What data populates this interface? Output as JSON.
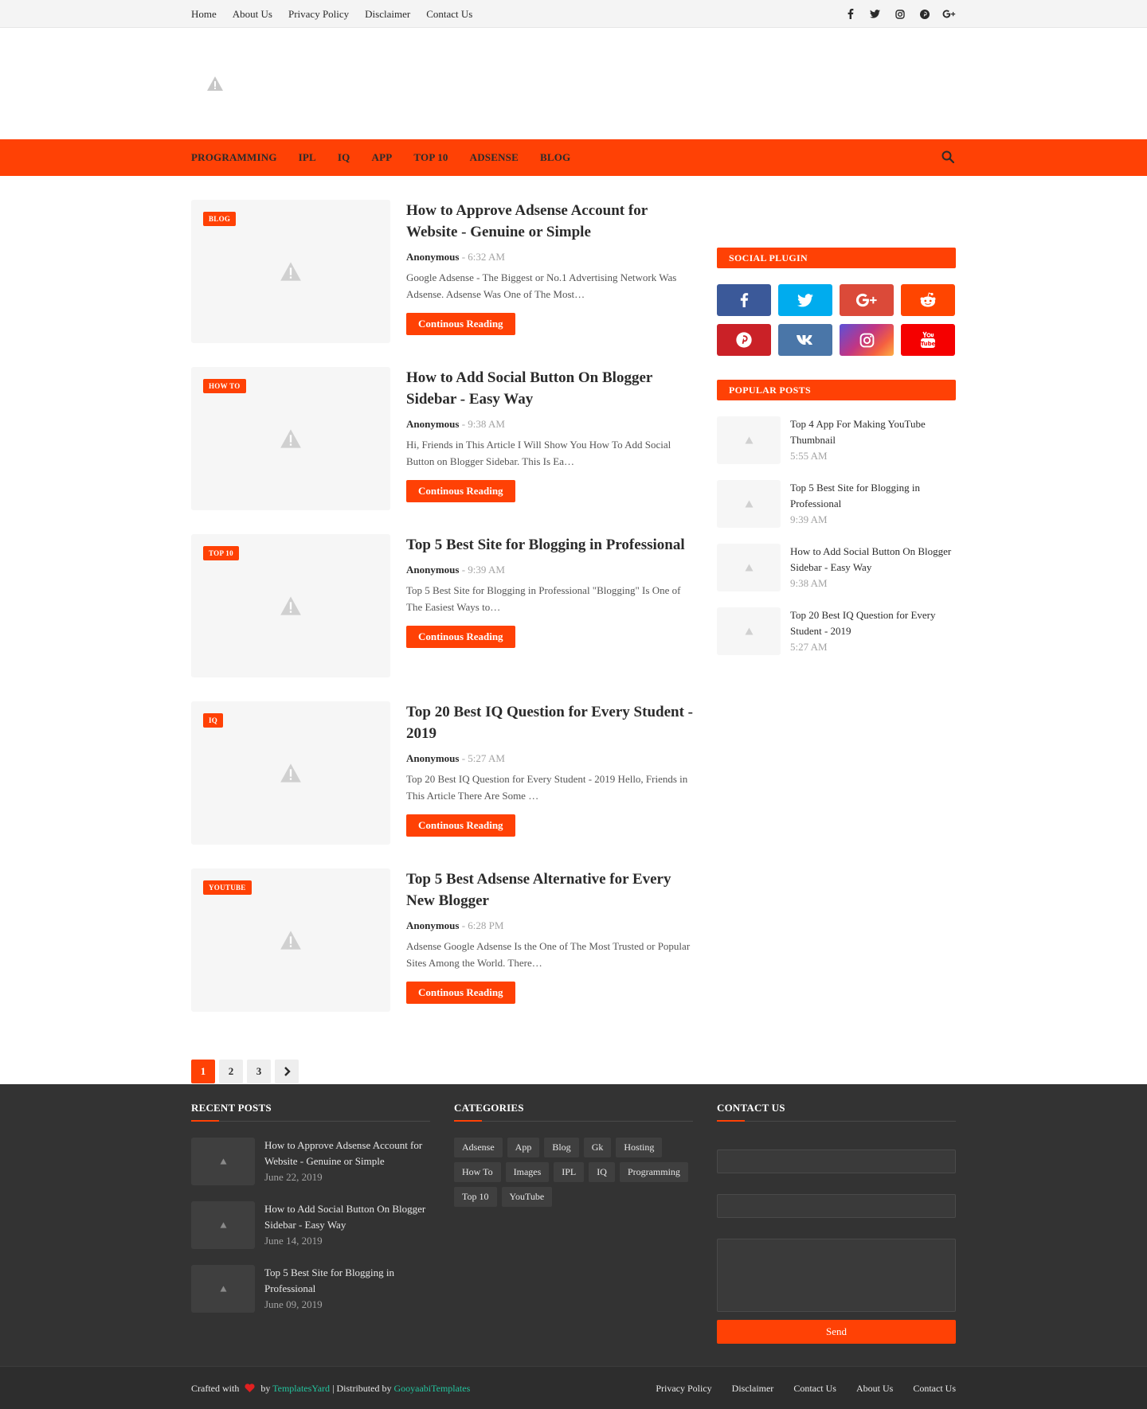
{
  "topbar": {
    "links": [
      "Home",
      "About Us",
      "Privacy Policy",
      "Disclaimer",
      "Contact Us"
    ],
    "social_icons": [
      "facebook-icon",
      "twitter-icon",
      "instagram-icon",
      "pinterest-icon",
      "google-plus-icon"
    ]
  },
  "nav": {
    "items": [
      "PROGRAMMING",
      "IPL",
      "IQ",
      "APP",
      "TOP 10",
      "ADSENSE",
      "BLOG"
    ]
  },
  "colors": {
    "accent": "#ff4105",
    "footer_bg": "#333333",
    "link_green": "#23c49e"
  },
  "posts": [
    {
      "tag": "BLOG",
      "title": "How to Approve Adsense Account for Website - Genuine or Simple",
      "author": "Anonymous",
      "time": "- 6:32 AM",
      "excerpt": "Google Adsense - The Biggest or No.1 Advertising Network Was Adsense. Adsense Was One of The Most…",
      "button": "Continous Reading"
    },
    {
      "tag": "HOW TO",
      "title": "How to Add Social Button On Blogger Sidebar - Easy Way",
      "author": "Anonymous",
      "time": "- 9:38 AM",
      "excerpt": "Hi, Friends in This Article I Will Show You How To Add Social Button on Blogger Sidebar. This Is Ea…",
      "button": "Continous Reading"
    },
    {
      "tag": "TOP 10",
      "title": "Top 5 Best Site for Blogging in Professional",
      "author": "Anonymous",
      "time": "- 9:39 AM",
      "excerpt": "Top 5 Best Site for Blogging in Professional \"Blogging\" Is One of The Easiest Ways to…",
      "button": "Continous Reading"
    },
    {
      "tag": "IQ",
      "title": "Top 20 Best IQ Question for Every Student - 2019",
      "author": "Anonymous",
      "time": "- 5:27 AM",
      "excerpt": "Top 20 Best IQ Question for Every Student - 2019 Hello, Friends in This Article There Are Some …",
      "button": "Continous Reading"
    },
    {
      "tag": "YOUTUBE",
      "title": "Top 5 Best Adsense Alternative for Every New Blogger",
      "author": "Anonymous",
      "time": "- 6:28 PM",
      "excerpt": "Adsense Google Adsense Is the One of The Most Trusted or Popular Sites Among the World. There…",
      "button": "Continous Reading"
    }
  ],
  "pager": {
    "pages": [
      "1",
      "2",
      "3"
    ],
    "active": "1"
  },
  "sidebar": {
    "social_title": "SOCIAL PLUGIN",
    "social_buttons": [
      {
        "icon": "facebook-icon",
        "color": "#3b5999"
      },
      {
        "icon": "twitter-icon",
        "color": "#00acee"
      },
      {
        "icon": "google-plus-icon",
        "color": "#db4a39"
      },
      {
        "icon": "reddit-icon",
        "color": "#ff4500"
      },
      {
        "icon": "pinterest-icon",
        "color": "#ca2127"
      },
      {
        "icon": "vk-icon",
        "color": "#4a76a8"
      },
      {
        "icon": "instagram-icon",
        "color": "#c13584"
      },
      {
        "icon": "youtube-icon",
        "color": "#f50000"
      }
    ],
    "popular_title": "POPULAR POSTS",
    "popular": [
      {
        "title": "Top 4 App For Making YouTube Thumbnail",
        "time": "5:55 AM"
      },
      {
        "title": "Top 5 Best Site for Blogging in Professional",
        "time": "9:39 AM"
      },
      {
        "title": "How to Add Social Button On Blogger Sidebar - Easy Way",
        "time": "9:38 AM"
      },
      {
        "title": "Top 20 Best IQ Question for Every Student - 2019",
        "time": "5:27 AM"
      }
    ]
  },
  "footer": {
    "recent_title": "RECENT POSTS",
    "recent": [
      {
        "title": "How to Approve Adsense Account for Website - Genuine or Simple",
        "date": "June 22, 2019"
      },
      {
        "title": "How to Add Social Button On Blogger Sidebar - Easy Way",
        "date": "June 14, 2019"
      },
      {
        "title": "Top 5 Best Site for Blogging in Professional",
        "date": "June 09, 2019"
      }
    ],
    "categories_title": "CATEGORIES",
    "categories": [
      "Adsense",
      "App",
      "Blog",
      "Gk",
      "Hosting",
      "How To",
      "Images",
      "IPL",
      "IQ",
      "Programming",
      "Top 10",
      "YouTube"
    ],
    "contact_title": "CONTACT US",
    "send_label": "Send"
  },
  "bottom": {
    "crafted": "Crafted with",
    "by": "by",
    "templatesyard": "TemplatesYard",
    "distributed": "| Distributed by",
    "gooyaabi": "GooyaabiTemplates",
    "links": [
      "Privacy Policy",
      "Disclaimer",
      "Contact Us",
      "About Us",
      "Contact Us"
    ]
  }
}
